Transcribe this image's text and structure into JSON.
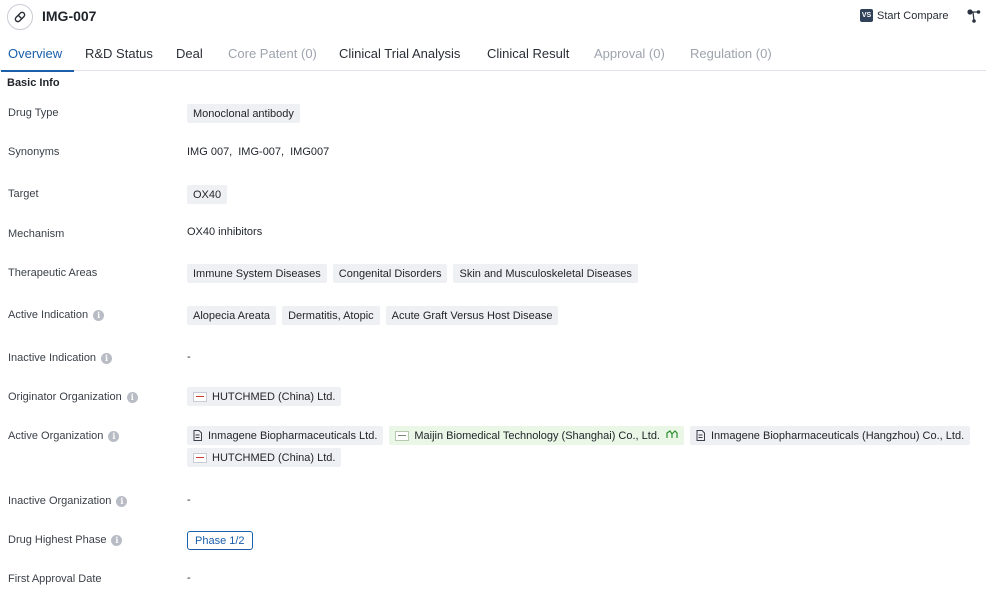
{
  "header": {
    "title": "IMG-007",
    "compare_icon_text": "VS",
    "compare_label": "Start Compare"
  },
  "tabs": [
    {
      "label": "Overview",
      "state": "active"
    },
    {
      "label": "R&D Status",
      "state": "enabled"
    },
    {
      "label": "Deal",
      "state": "enabled"
    },
    {
      "label": "Core Patent (0)",
      "state": "disabled"
    },
    {
      "label": "Clinical Trial Analysis",
      "state": "enabled"
    },
    {
      "label": "Clinical Result",
      "state": "enabled"
    },
    {
      "label": "Approval (0)",
      "state": "disabled"
    },
    {
      "label": "Regulation (0)",
      "state": "disabled"
    }
  ],
  "basic_info": {
    "section_title": "Basic Info",
    "drug_type": {
      "label": "Drug Type",
      "value": "Monoclonal antibody"
    },
    "synonyms": {
      "label": "Synonyms",
      "values": [
        "IMG 007,",
        "IMG-007,",
        "IMG007"
      ]
    },
    "target": {
      "label": "Target",
      "value": "OX40"
    },
    "mechanism": {
      "label": "Mechanism",
      "value": "OX40 inhibitors"
    },
    "therapeutic_areas": {
      "label": "Therapeutic Areas",
      "values": [
        "Immune System Diseases",
        "Congenital Disorders",
        "Skin and Musculoskeletal Diseases"
      ]
    },
    "active_indication": {
      "label": "Active Indication",
      "values": [
        "Alopecia Areata",
        "Dermatitis, Atopic",
        "Acute Graft Versus Host Disease"
      ]
    },
    "inactive_indication": {
      "label": "Inactive Indication",
      "value": "-"
    },
    "originator_org": {
      "label": "Originator Organization",
      "value": "HUTCHMED (China) Ltd."
    },
    "active_org": {
      "label": "Active Organization",
      "values": [
        "Inmagene Biopharmaceuticals Ltd.",
        "Maijin Biomedical Technology (Shanghai) Co., Ltd.",
        "Inmagene Biopharmaceuticals (Hangzhou) Co., Ltd.",
        "HUTCHMED (China) Ltd."
      ]
    },
    "inactive_org": {
      "label": "Inactive Organization",
      "value": "-"
    },
    "highest_phase": {
      "label": "Drug Highest Phase",
      "value": "Phase 1/2"
    },
    "first_approval": {
      "label": "First Approval Date",
      "value": "-"
    }
  },
  "colors": {
    "accent": "#1a5fa8",
    "tag_bg": "#eef0f3",
    "tag_green_bg": "#eaf6e6",
    "disabled_text": "#9ea3ad"
  },
  "icons": [
    "pill-icon",
    "vs-icon",
    "tree-icon",
    "info-icon",
    "company-logo-icon",
    "document-icon",
    "growth-chart-icon"
  ]
}
